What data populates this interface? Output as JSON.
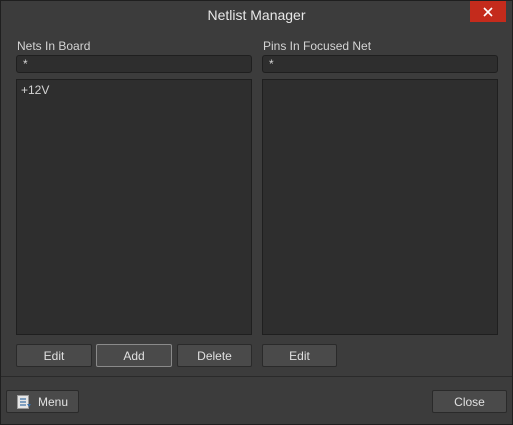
{
  "window": {
    "title": "Netlist Manager",
    "close_glyph": "✕"
  },
  "nets_panel": {
    "label": "Nets In Board",
    "filter_value": "*",
    "items": [
      "+12V"
    ],
    "buttons": {
      "edit": "Edit",
      "add": "Add",
      "delete": "Delete"
    }
  },
  "pins_panel": {
    "label": "Pins In Focused Net",
    "filter_value": "*",
    "items": [],
    "buttons": {
      "edit": "Edit"
    }
  },
  "footer": {
    "menu": "Menu",
    "close": "Close"
  },
  "icons": {
    "menu": "menu-list-icon",
    "close_window": "close-icon"
  },
  "colors": {
    "close_button": "#c42b1c",
    "background": "#3c3c3c",
    "panel": "#2e2e2e"
  }
}
